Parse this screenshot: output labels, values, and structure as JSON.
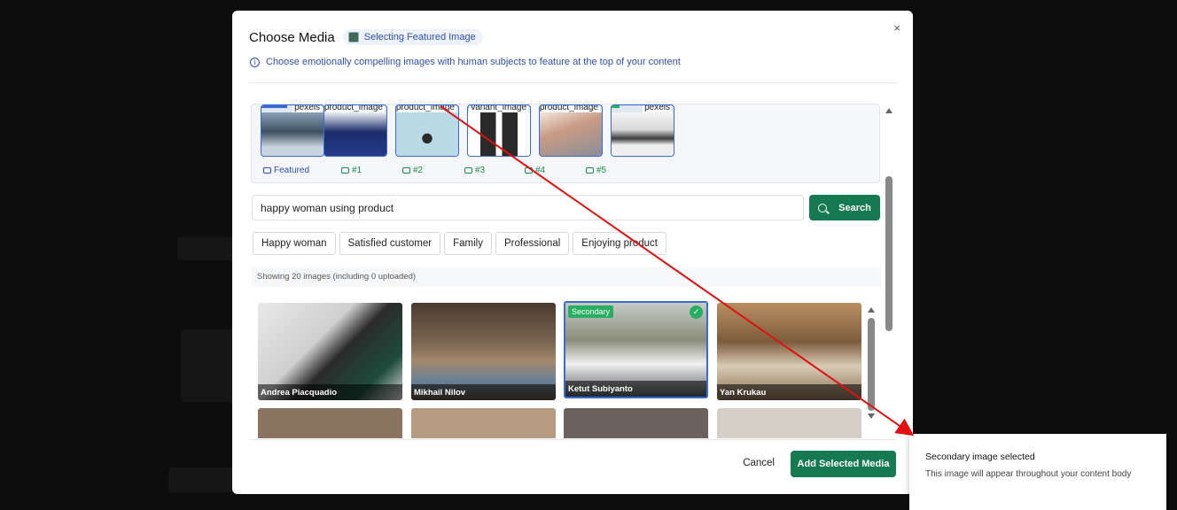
{
  "modal": {
    "title": "Choose Media",
    "pill_label": "Selecting Featured Image",
    "info_text": "Choose emotionally compelling images with human subjects to feature at the top of your content",
    "close_glyph": "×"
  },
  "strip": {
    "thumbs": [
      {
        "source": "pexels",
        "label": "Featured"
      },
      {
        "source": "product_image",
        "label": "#1"
      },
      {
        "source": "product_image",
        "label": "#2"
      },
      {
        "source": "variant_image",
        "label": "#3"
      },
      {
        "source": "product_image",
        "label": "#4"
      },
      {
        "source": "pexels",
        "label": "#5"
      }
    ]
  },
  "search": {
    "value": "happy woman using product",
    "button_label": "Search"
  },
  "chips": [
    "Happy woman",
    "Satisfied customer",
    "Family",
    "Professional",
    "Enjoying product"
  ],
  "showing_text": "Showing 20 images (including 0 uploaded)",
  "grid": {
    "tiles": [
      {
        "caption": "Andrea Piacquadio"
      },
      {
        "caption": "Mikhail Nilov"
      },
      {
        "caption": "Ketut Subiyanto",
        "badge": "Secondary",
        "check": "✓"
      },
      {
        "caption": "Yan Krukau"
      }
    ]
  },
  "footer": {
    "cancel_label": "Cancel",
    "add_label": "Add Selected Media"
  },
  "toast": {
    "title": "Secondary image selected",
    "message": "This image will appear throughout your content body"
  },
  "colors": {
    "primary": "#157a4f",
    "accent_blue": "#2d4fb1",
    "success": "#27ae60",
    "annotation_arrow": "#e01010"
  }
}
